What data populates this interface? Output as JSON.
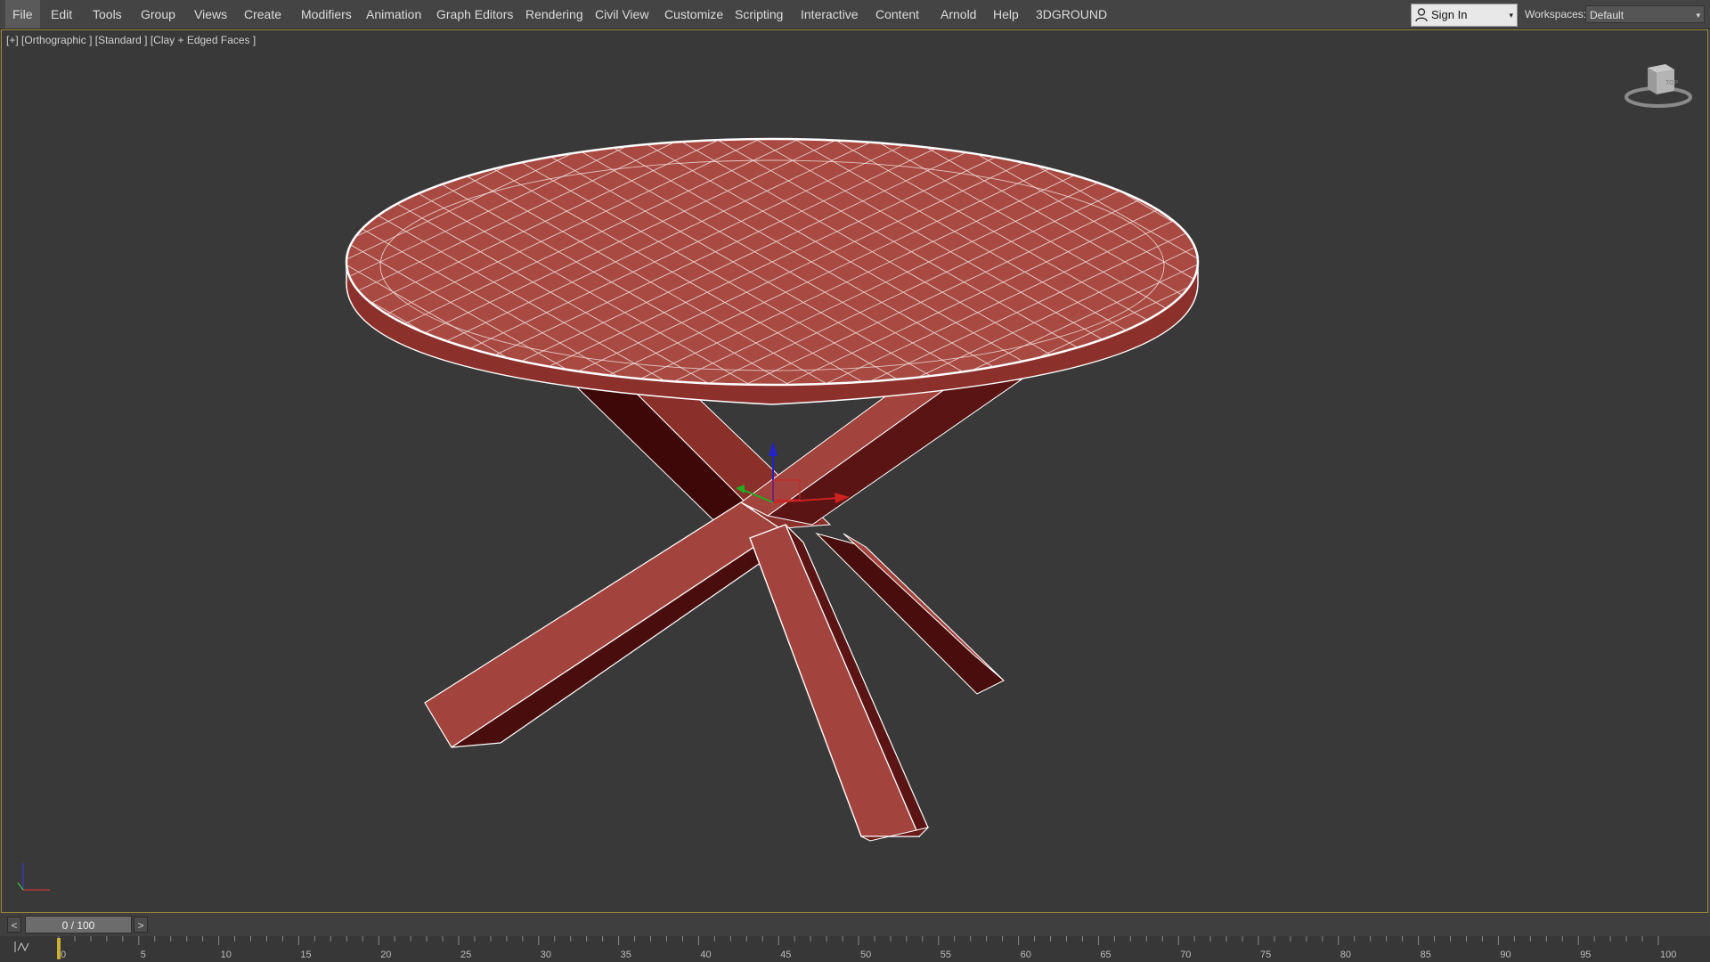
{
  "menu": {
    "items": [
      "File",
      "Edit",
      "Tools",
      "Group",
      "Views",
      "Create",
      "Modifiers",
      "Animation",
      "Graph Editors",
      "Rendering",
      "Civil View",
      "Customize",
      "Scripting",
      "Interactive",
      "Content",
      "Arnold",
      "Help",
      "3DGROUND"
    ],
    "active": "File"
  },
  "account": {
    "signin_label": "Sign In"
  },
  "workspace": {
    "label": "Workspaces:",
    "value": "Default"
  },
  "viewport": {
    "plus": "[+]",
    "view": "[Orthographic ]",
    "shading_mode": "[Standard ]",
    "display_mode": "[Clay + Edged Faces ]",
    "background_color": "#393939",
    "object_color": "#a84a42",
    "edge_color": "#ffffff",
    "viewcube_face": "TOP"
  },
  "time": {
    "slider_value": "0 / 100",
    "prev_label": "<",
    "next_label": ">",
    "curve_icon": "mini-curve-editor-icon",
    "ticks": [
      0,
      5,
      10,
      15,
      20,
      25,
      30,
      35,
      40,
      45,
      50,
      55,
      60,
      65,
      70,
      75,
      80,
      85,
      90,
      95,
      100
    ]
  }
}
